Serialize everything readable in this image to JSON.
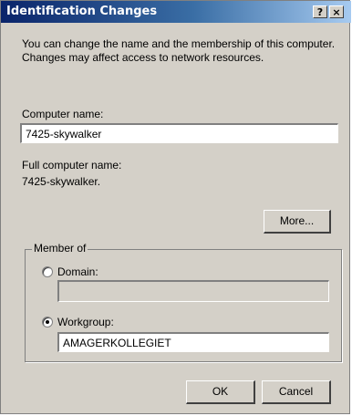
{
  "window": {
    "title": "Identification Changes",
    "help_label": "?",
    "close_label": "×"
  },
  "description": "You can change the name and the membership of this computer. Changes may affect access to network resources.",
  "computer_name": {
    "label": "Computer name:",
    "value": "7425-skywalker"
  },
  "full_name": {
    "label": "Full computer name:",
    "value": "7425-skywalker."
  },
  "more_button": "More...",
  "member_of": {
    "label": "Member of",
    "domain": {
      "label": "Domain:",
      "selected": false,
      "value": ""
    },
    "workgroup": {
      "label": "Workgroup:",
      "selected": true,
      "value": "AMAGERKOLLEGIET"
    }
  },
  "buttons": {
    "ok": "OK",
    "cancel": "Cancel"
  }
}
